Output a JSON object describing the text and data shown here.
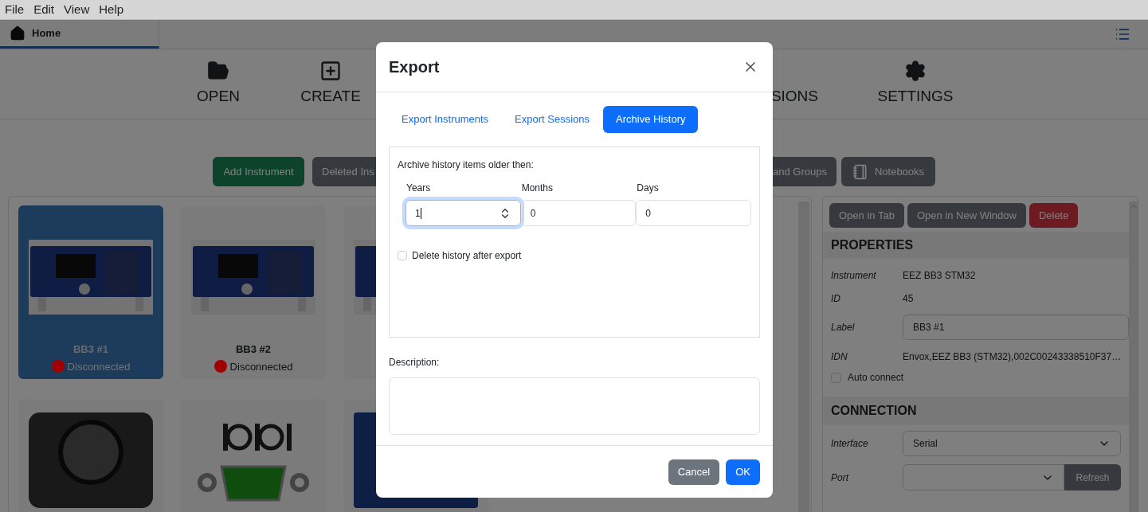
{
  "menu": [
    {
      "label": "File"
    },
    {
      "label": "Edit"
    },
    {
      "label": "View"
    },
    {
      "label": "Help"
    }
  ],
  "tabs": [
    {
      "label": "Home",
      "selected": true
    }
  ],
  "nav": [
    {
      "label": "OPEN",
      "kind": "open"
    },
    {
      "label": "CREATE",
      "kind": "create"
    },
    {
      "label": "SIONS",
      "kind": "partial"
    },
    {
      "label": "SETTINGS",
      "kind": "settings"
    }
  ],
  "toolbar": [
    {
      "label": "Add Instrument",
      "kind": "success"
    },
    {
      "label": "Deleted Ins",
      "kind": "secondary"
    },
    {
      "label": "and Groups",
      "kind": "secondary-cut"
    },
    {
      "label": "Notebooks",
      "kind": "notebooks"
    }
  ],
  "instruments": [
    {
      "kind": "bb3",
      "label": "BB3 #1",
      "status": "Disconnected",
      "color": "#a00000",
      "selected": true
    },
    {
      "kind": "bb3",
      "label": "BB3 #2",
      "status": "Disconnected",
      "color": "#a00000",
      "selected": false
    },
    {
      "kind": "bb3",
      "selected": false
    },
    {
      "kind": "no-image",
      "selected": false
    },
    {
      "kind": "serial",
      "selected": false
    },
    {
      "kind": "board",
      "selected": false
    }
  ],
  "details": {
    "actions": [
      {
        "label": "Open in Tab",
        "kind": "secondary"
      },
      {
        "label": "Open in New Window",
        "kind": "secondary"
      },
      {
        "label": "Delete",
        "kind": "danger"
      }
    ],
    "properties_title": "PROPERTIES",
    "properties": [
      {
        "label": "Instrument",
        "value": "EEZ BB3 STM32",
        "kind": "text"
      },
      {
        "label": "ID",
        "value": "45",
        "kind": "text"
      },
      {
        "label": "Label",
        "value": "BB3 #1",
        "kind": "input"
      },
      {
        "label": "IDN",
        "value": "Envox,EEZ BB3 (STM32),002C00243338510F37…",
        "kind": "text"
      }
    ],
    "auto_connect": {
      "label": "Auto connect",
      "checked": false
    },
    "connection_title": "CONNECTION",
    "interface": {
      "label": "Interface",
      "value": "Serial"
    },
    "port": {
      "label": "Port",
      "button": "Refresh"
    }
  },
  "dialog": {
    "title": "Export",
    "tabs": [
      {
        "label": "Export Instruments",
        "selected": false
      },
      {
        "label": "Export Sessions",
        "selected": false
      },
      {
        "label": "Archive History",
        "selected": true
      }
    ],
    "legend": "Archive history items older then:",
    "fields": [
      {
        "label": "Years",
        "value": "1",
        "focused": true
      },
      {
        "label": "Months",
        "value": "0",
        "focused": false
      },
      {
        "label": "Days",
        "value": "0",
        "focused": false
      }
    ],
    "delete_after": {
      "label": "Delete history after export",
      "checked": false
    },
    "description_label": "Description:",
    "buttons": [
      {
        "label": "Cancel",
        "kind": "secondary"
      },
      {
        "label": "OK",
        "kind": "primary"
      }
    ]
  }
}
